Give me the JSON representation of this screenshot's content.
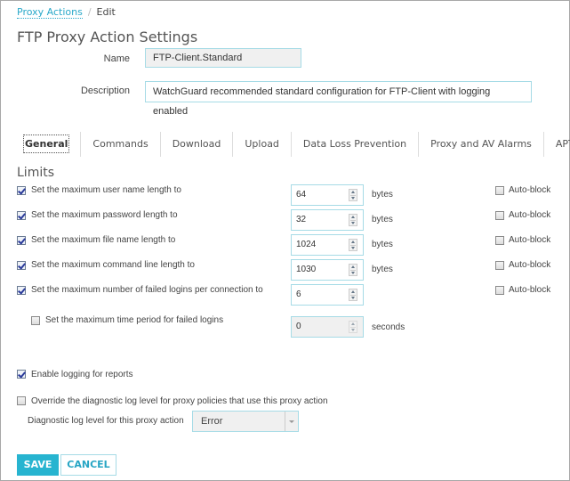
{
  "breadcrumb": {
    "parent": "Proxy Actions",
    "separator": "/",
    "current": "Edit"
  },
  "page_title": "FTP Proxy Action Settings",
  "form": {
    "name_label": "Name",
    "name_value": "FTP-Client.Standard",
    "description_label": "Description",
    "description_value": "WatchGuard recommended standard configuration for FTP-Client with logging enabled"
  },
  "tabs": [
    {
      "label": "General",
      "active": true
    },
    {
      "label": "Commands"
    },
    {
      "label": "Download"
    },
    {
      "label": "Upload"
    },
    {
      "label": "Data Loss Prevention"
    },
    {
      "label": "Proxy and AV Alarms"
    },
    {
      "label": "APT Blocker"
    }
  ],
  "limits": {
    "title": "Limits",
    "rows": [
      {
        "label": "Set the maximum user name length to",
        "checked": true,
        "value": "64",
        "unit": "bytes",
        "autoblock_label": "Auto-block",
        "autoblock": false
      },
      {
        "label": "Set the maximum password length to",
        "checked": true,
        "value": "32",
        "unit": "bytes",
        "autoblock_label": "Auto-block",
        "autoblock": false
      },
      {
        "label": "Set the maximum file name length to",
        "checked": true,
        "value": "1024",
        "unit": "bytes",
        "autoblock_label": "Auto-block",
        "autoblock": false
      },
      {
        "label": "Set the maximum command line length to",
        "checked": true,
        "value": "1030",
        "unit": "bytes",
        "autoblock_label": "Auto-block",
        "autoblock": false
      },
      {
        "label": "Set the maximum number of failed logins per connection to",
        "checked": true,
        "value": "6",
        "unit": "",
        "autoblock_label": "Auto-block",
        "autoblock": false
      }
    ],
    "time_period": {
      "label": "Set the maximum time period for failed logins",
      "checked": false,
      "value": "0",
      "unit": "seconds"
    }
  },
  "logging": {
    "label": "Enable logging for reports",
    "checked": true
  },
  "override": {
    "label": "Override the diagnostic log level for proxy policies that use this proxy action",
    "checked": false
  },
  "diag_level": {
    "label": "Diagnostic log level for this proxy action",
    "value": "Error"
  },
  "buttons": {
    "save": "SAVE",
    "cancel": "CANCEL"
  },
  "colors": {
    "accent": "#27b4d0",
    "input_border": "#a6dbe6"
  }
}
